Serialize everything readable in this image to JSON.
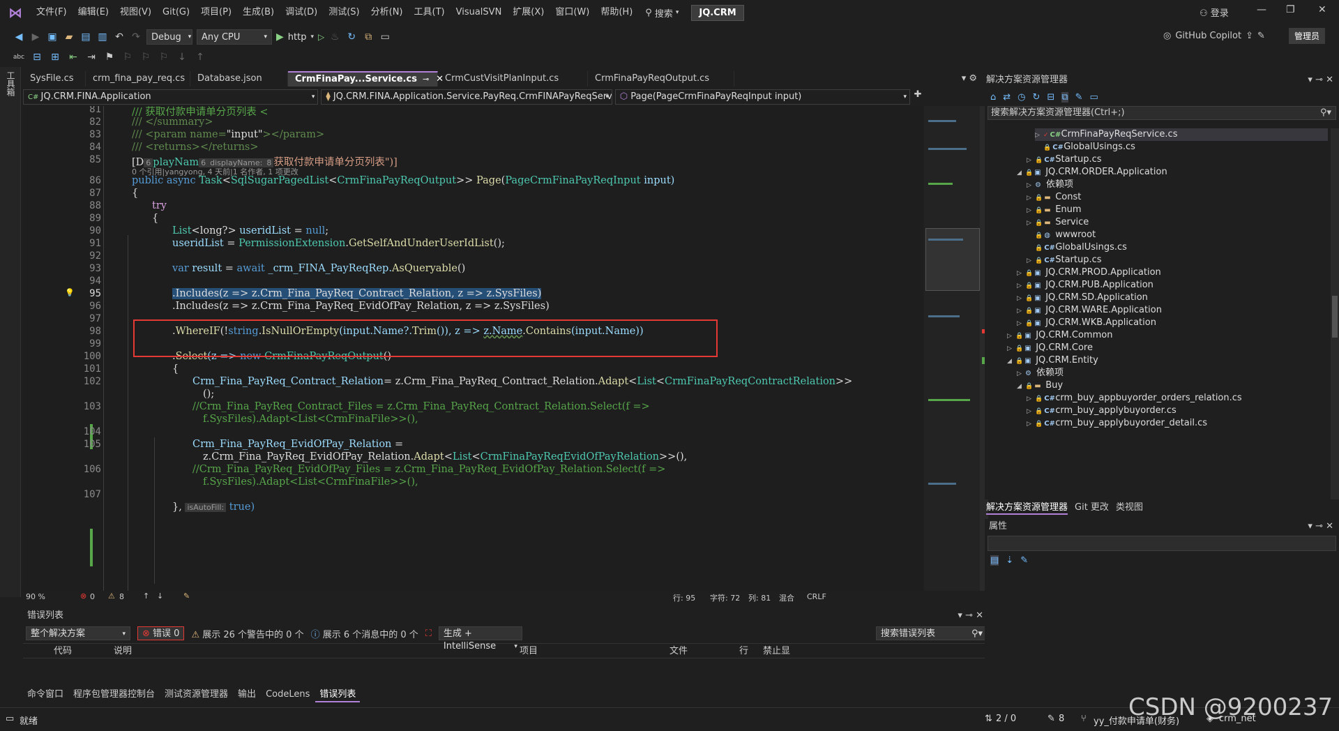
{
  "menu": [
    "文件(F)",
    "编辑(E)",
    "视图(V)",
    "Git(G)",
    "项目(P)",
    "生成(B)",
    "调试(D)",
    "测试(S)",
    "分析(N)",
    "工具(T)",
    "VisualSVN",
    "扩展(X)",
    "窗口(W)",
    "帮助(H)"
  ],
  "search_label": "搜索",
  "project_badge": "JQ.CRM",
  "login_label": "登录",
  "toolbar": {
    "config": "Debug",
    "platform": "Any CPU",
    "run": "http"
  },
  "copilot_label": "GitHub Copilot",
  "admin_label": "管理员",
  "side_strip_label": "工具箱",
  "tabs": [
    {
      "label": "SysFile.cs"
    },
    {
      "label": "crm_fina_pay_req.cs"
    },
    {
      "label": "Database.json"
    },
    {
      "label": "CrmFinaPay...Service.cs"
    },
    {
      "label": "CrmCustVisitPlanInput.cs"
    },
    {
      "label": "CrmFinaPayReqOutput.cs"
    }
  ],
  "nav": {
    "project": "JQ.CRM.FINA.Application",
    "class": "JQ.CRM.FINA.Application.Service.PayReq.CrmFINAPayReqServic",
    "member": "Page(PageCrmFinaPayReqInput input)"
  },
  "code": {
    "l81": "/// 获取付款申请单分页列表 <",
    "l82": "/// </summary>",
    "l83a": "/// <param name=",
    "l83b": "\"input\"",
    "l83c": "></param>",
    "l84": "/// <returns></returns>",
    "l85a": "[D",
    "l85b": "playNam",
    "l85hint": "displayName:",
    "l85c": "获取付款申请单分页列表\")]",
    "refs": "0 个引用|yangyong, 4 天前|1 名作者, 1 项更改",
    "l86a": "public async ",
    "l86b": "Task",
    "l86c": "<",
    "l86d": "SqlSugarPagedList",
    "l86e": "<",
    "l86f": "CrmFinaPayReqOutput",
    "l86g": ">> ",
    "l86h": "Page",
    "l86i": "(",
    "l86j": "PageCrmFinaPayReqInput",
    "l86k": " input)",
    "l87": "{",
    "l88": "try",
    "l89": "{",
    "l90a": "List",
    "l90b": "<long?> ",
    "l90c": "useridList",
    "l90d": " = ",
    "l90e": "null",
    "l90f": ";",
    "l91a": "useridList",
    "l91b": " = ",
    "l91c": "PermissionExtension",
    "l91d": ".",
    "l91e": "GetSelfAndUnderUserIdList",
    "l91f": "();",
    "l93a": "var ",
    "l93b": "result",
    "l93c": " = ",
    "l93d": "await ",
    "l93e": "_crm_FINA_PayReqRep.",
    "l93f": "AsQueryable",
    "l93g": "()",
    "l95": ".Includes(z => z.Crm_Fina_PayReq_Contract_Relation, z => z.SysFiles)",
    "l96": ".Includes(z => z.Crm_Fina_PayReq_EvidOfPay_Relation, z => z.SysFiles)",
    "l98a": ".",
    "l98b": "WhereIF",
    "l98c": "(!",
    "l98d": "string",
    "l98e": ".",
    "l98f": "IsNullOrEmpty",
    "l98g": "(input.Name?.",
    "l98h": "Trim",
    "l98i": "()), z => ",
    "l98j": "z.Name",
    "l98k": ".",
    "l98l": "Contains",
    "l98m": "(input.Name))",
    "l100a": ".",
    "l100b": "Select",
    "l100c": "(z => ",
    "l100d": "new ",
    "l100e": "CrmFinaPayReqOutput",
    "l100f": "()",
    "l101": "{",
    "l102a": "Crm_Fina_PayReq_Contract_Relation",
    "l102b": "= z.Crm_Fina_PayReq_Contract_Relation.",
    "l102c": "Adapt",
    "l102d": "<",
    "l102e": "List",
    "l102f": "<",
    "l102g": "CrmFinaPayReqContractRelation",
    "l102h": ">>",
    "l102i": "();",
    "l103a": "//Crm_Fina_PayReq_Contract_Files = z.Crm_Fina_PayReq_Contract_Relation.Select(f =>",
    "l103b": "f.SysFiles).Adapt<List<CrmFinaFile>>(),",
    "l105a": "Crm_Fina_PayReq_EvidOfPay_Relation",
    "l105b": " =",
    "l105c": "z.Crm_Fina_PayReq_EvidOfPay_Relation.",
    "l105d": "Adapt",
    "l105e": "<",
    "l105f": "List",
    "l105g": "<",
    "l105h": "CrmFinaPayReqEvidOfPayRelation",
    "l105i": ">>(),",
    "l106a": "//Crm_Fina_PayReq_EvidOfPay_Files = z.Crm_Fina_PayReq_EvidOfPay_Relation.Select(f =>",
    "l106b": "f.SysFiles).Adapt<List<CrmFinaFile>>(),",
    "l108a": "},",
    "l108hint": "isAutoFill:",
    "l108b": "true)"
  },
  "line_numbers": [
    "81",
    "82",
    "83",
    "84",
    "85",
    "86",
    "87",
    "88",
    "89",
    "90",
    "91",
    "92",
    "93",
    "94",
    "95",
    "96",
    "97",
    "98",
    "99",
    "100",
    "101",
    "102",
    "103",
    "104",
    "105",
    "106",
    "107"
  ],
  "hint_values": {
    "h1": "6",
    "h2": "8"
  },
  "editor_status": {
    "zoom": "90 %",
    "errors": "0",
    "warnings": "8",
    "line": "行: 95",
    "char": "字符: 72",
    "col": "列: 81",
    "mix": "混合",
    "eol": "CRLF"
  },
  "error_list": {
    "title": "错误列表",
    "scope": "整个解决方案",
    "errors_btn": "错误 0",
    "warnings_btn": "展示 26 个警告中的 0 个",
    "messages_btn": "展示 6 个消息中的 0 个",
    "build_filter": "生成 + IntelliSense",
    "search_placeholder": "搜索错误列表",
    "columns": [
      "代码",
      "说明",
      "项目",
      "文件",
      "行",
      "禁止显"
    ]
  },
  "bottom_tabs": [
    "命令窗口",
    "程序包管理器控制台",
    "测试资源管理器",
    "输出",
    "CodeLens",
    "错误列表"
  ],
  "solution": {
    "title": "解决方案资源管理器",
    "search": "搜索解决方案资源管理器(Ctrl+;)",
    "items": [
      {
        "label": "CrmFinaPayReqService.cs",
        "icon": "C#"
      },
      {
        "label": "GlobalUsings.cs",
        "icon": "C#"
      },
      {
        "label": "Startup.cs",
        "icon": "C#"
      },
      {
        "label": "JQ.CRM.ORDER.Application",
        "icon": "proj"
      },
      {
        "label": "依赖项",
        "icon": "deps"
      },
      {
        "label": "Const",
        "icon": "folder"
      },
      {
        "label": "Enum",
        "icon": "folder"
      },
      {
        "label": "Service",
        "icon": "folder"
      },
      {
        "label": "wwwroot",
        "icon": "globe"
      },
      {
        "label": "GlobalUsings.cs",
        "icon": "C#"
      },
      {
        "label": "Startup.cs",
        "icon": "C#"
      },
      {
        "label": "JQ.CRM.PROD.Application",
        "icon": "proj"
      },
      {
        "label": "JQ.CRM.PUB.Application",
        "icon": "proj"
      },
      {
        "label": "JQ.CRM.SD.Application",
        "icon": "proj"
      },
      {
        "label": "JQ.CRM.WARE.Application",
        "icon": "proj"
      },
      {
        "label": "JQ.CRM.WKB.Application",
        "icon": "proj"
      },
      {
        "label": "JQ.CRM.Common",
        "icon": "proj"
      },
      {
        "label": "JQ.CRM.Core",
        "icon": "proj"
      },
      {
        "label": "JQ.CRM.Entity",
        "icon": "proj"
      },
      {
        "label": "依赖项",
        "icon": "deps"
      },
      {
        "label": "Buy",
        "icon": "folder"
      },
      {
        "label": "crm_buy_appbuyorder_orders_relation.cs",
        "icon": "C#"
      },
      {
        "label": "crm_buy_applybuyorder.cs",
        "icon": "C#"
      },
      {
        "label": "crm_buy_applybuyorder_detail.cs",
        "icon": "C#"
      }
    ],
    "tabs": [
      "解决方案资源管理器",
      "Git 更改",
      "类视图"
    ]
  },
  "properties_title": "属性",
  "statusbar": {
    "ready": "就绪",
    "git_changes": "2 / 0",
    "pencil_count": "8",
    "branch": "yy_付款申请单(财务)",
    "repo": "crm_net"
  },
  "watermark": "CSDN @9200237",
  "colors": {
    "accent": "#b180d7",
    "selection": "#264f78",
    "highlight_box": "#e53935"
  }
}
